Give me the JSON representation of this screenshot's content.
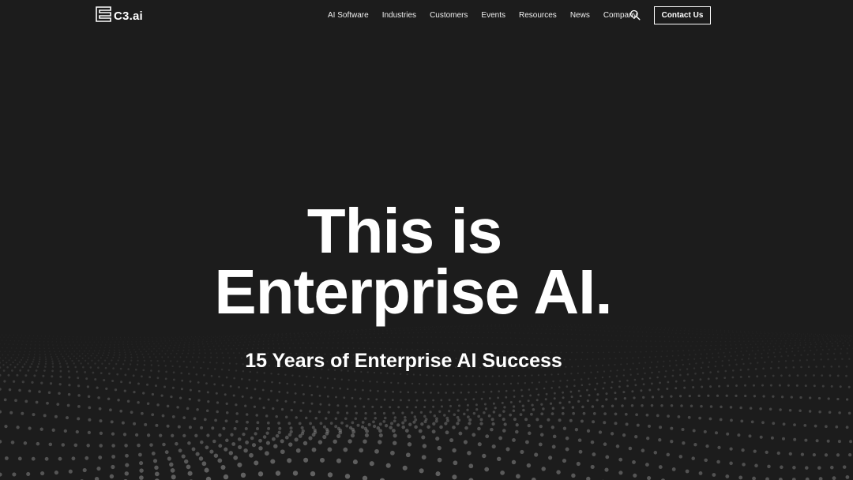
{
  "brand": {
    "name": "C3.ai",
    "logo_icon": "c3-logo-icon"
  },
  "nav": {
    "items": [
      {
        "label": "AI Software"
      },
      {
        "label": "Industries"
      },
      {
        "label": "Customers"
      },
      {
        "label": "Events"
      },
      {
        "label": "Resources"
      },
      {
        "label": "News"
      },
      {
        "label": "Company"
      }
    ],
    "search_icon": "search-icon",
    "contact_label": "Contact Us"
  },
  "hero": {
    "line1": "This is",
    "line2": "Enterprise AI.",
    "subtitle": "15 Years of Enterprise AI Success"
  },
  "colors": {
    "background": "#1c1c1c",
    "text": "#ffffff",
    "dots": "#8a8a8a"
  }
}
